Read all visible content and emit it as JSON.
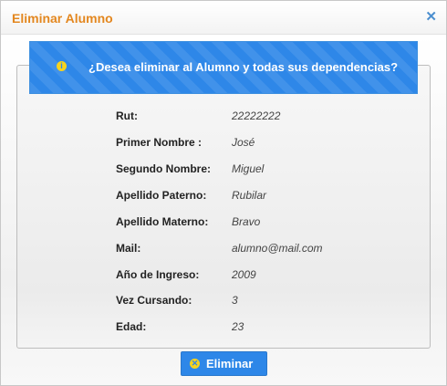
{
  "dialog": {
    "title": "Eliminar Alumno",
    "close_icon": "close-icon"
  },
  "alert": {
    "icon": "info-icon",
    "message": "¿Desea eliminar al Alumno y todas sus dependencias?"
  },
  "fields": [
    {
      "label": "Rut:",
      "value": "22222222"
    },
    {
      "label": "Primer Nombre :",
      "value": "José"
    },
    {
      "label": "Segundo Nombre:",
      "value": "Miguel"
    },
    {
      "label": "Apellido Paterno:",
      "value": "Rubilar"
    },
    {
      "label": "Apellido Materno:",
      "value": "Bravo"
    },
    {
      "label": "Mail:",
      "value": "alumno@mail.com"
    },
    {
      "label": "Año de Ingreso:",
      "value": "2009"
    },
    {
      "label": "Vez Cursando:",
      "value": "3"
    },
    {
      "label": "Edad:",
      "value": "23"
    }
  ],
  "actions": {
    "delete_icon": "close-circle-icon",
    "delete_label": "Eliminar"
  },
  "colors": {
    "title": "#e3871f",
    "accent": "#2e87e8",
    "icon_yellow": "#f6d31e"
  }
}
